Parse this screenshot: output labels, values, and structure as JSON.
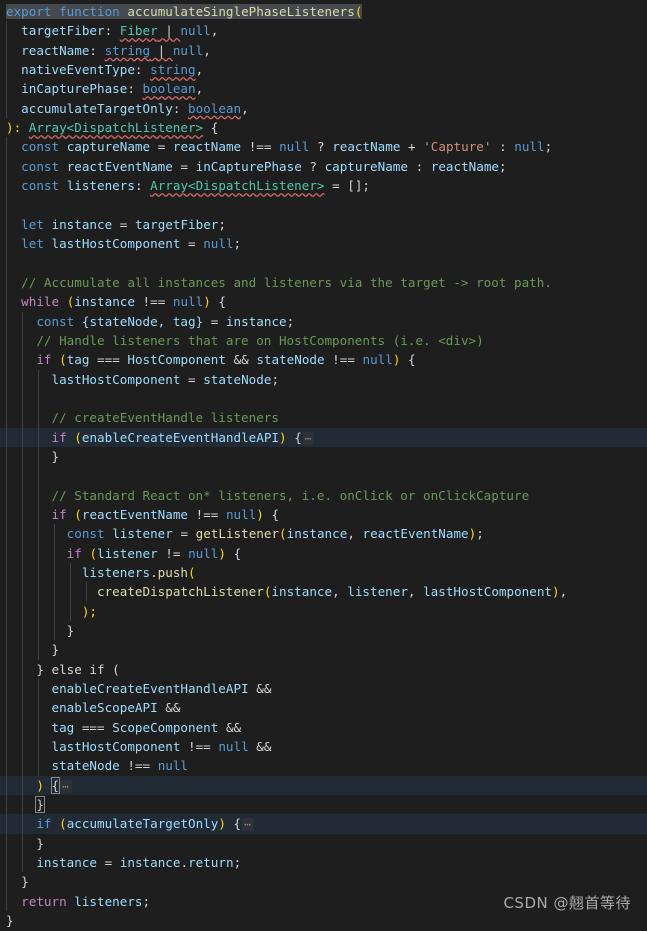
{
  "editor": {
    "language": "flow-javascript",
    "theme": "dark-plus",
    "background": "#1E1E1E",
    "foreground": "#D4D4D4",
    "selection_color": "#46494E",
    "highlight_color": "#222B35",
    "colors": {
      "keyword": "#569CD6",
      "control": "#C586C0",
      "function": "#DCDCAA",
      "identifier": "#9CDCFE",
      "type": "#4EC9B0",
      "string": "#CE9178",
      "comment": "#6A9955",
      "punctuation": "#D4D4D4",
      "error_squiggle": "#D16969",
      "fold_placeholder": "#8A8A8A"
    },
    "fold_placeholder": "⋯"
  },
  "code": {
    "l1": {
      "a": "export",
      "b": "function",
      "c": "accumulateSinglePhaseListeners",
      "d": "("
    },
    "l2": {
      "a": "targetFiber",
      "b": ": ",
      "c": "Fiber",
      "d": " | ",
      "e": "null",
      "f": ","
    },
    "l3": {
      "a": "reactName",
      "b": ": ",
      "c": "string",
      "d": " | ",
      "e": "null",
      "f": ","
    },
    "l4": {
      "a": "nativeEventType",
      "b": ": ",
      "c": "string",
      "d": ","
    },
    "l5": {
      "a": "inCapturePhase",
      "b": ": ",
      "c": "boolean",
      "d": ","
    },
    "l6": {
      "a": "accumulateTargetOnly",
      "b": ": ",
      "c": "boolean",
      "d": ","
    },
    "l7": {
      "a": "): ",
      "b": "Array<DispatchListener>",
      "c": " {"
    },
    "l8": {
      "a": "const",
      "b": "captureName",
      "c": "reactName",
      "d": "!==",
      "e": "null",
      "f": "?",
      "g": "reactName",
      "h": "+",
      "i": "'Capture'",
      "j": ":",
      "k": "null",
      "l": ";"
    },
    "l9": {
      "a": "const",
      "b": "reactEventName",
      "c": "inCapturePhase",
      "d": "?",
      "e": "captureName",
      "f": ":",
      "g": "reactName",
      "h": ";"
    },
    "l10": {
      "a": "const",
      "b": "listeners",
      "c": "Array<DispatchListener>",
      "d": " = [];"
    },
    "l11": "",
    "l12": {
      "a": "let",
      "b": "instance",
      "c": "targetFiber",
      "d": ";"
    },
    "l13": {
      "a": "let",
      "b": "lastHostComponent",
      "c": "null",
      "d": ";"
    },
    "l14": "",
    "l15": {
      "comment": "// Accumulate all instances and listeners via the target -> root path."
    },
    "l16": {
      "a": "while",
      "b": "instance",
      "c": "!==",
      "d": "null"
    },
    "l17": {
      "a": "const",
      "b": "{stateNode, tag}",
      "c": "instance"
    },
    "l18": {
      "comment": "// Handle listeners that are on HostComponents (i.e. <div>)"
    },
    "l19": {
      "a": "if",
      "b": "tag",
      "c": "===",
      "d": "HostComponent",
      "e": "&&",
      "f": "stateNode",
      "g": "!==",
      "h": "null"
    },
    "l20": {
      "a": "lastHostComponent",
      "b": "stateNode"
    },
    "l21": "",
    "l22": {
      "comment": "// createEventHandle listeners"
    },
    "l23": {
      "a": "if",
      "b": "enableCreateEventHandleAPI",
      "folded": true
    },
    "l24": {
      "a": "}"
    },
    "l25": "",
    "l26": {
      "comment": "// Standard React on* listeners, i.e. onClick or onClickCapture"
    },
    "l27": {
      "a": "if",
      "b": "reactEventName",
      "c": "!==",
      "d": "null"
    },
    "l28": {
      "a": "const",
      "b": "listener",
      "c": "getListener",
      "d": "instance",
      "e": "reactEventName"
    },
    "l29": {
      "a": "if",
      "b": "listener",
      "c": "!=",
      "d": "null"
    },
    "l30": {
      "a": "listeners",
      "b": "push"
    },
    "l31": {
      "a": "createDispatchListener",
      "b": "instance",
      "c": "listener",
      "d": "lastHostComponent"
    },
    "l32": {
      "a": ");"
    },
    "l33": {
      "a": "}"
    },
    "l34": {
      "a": "}"
    },
    "l35": {
      "a": "} else if ("
    },
    "l36": {
      "a": "enableCreateEventHandleAPI",
      "b": "&&"
    },
    "l37": {
      "a": "enableScopeAPI",
      "b": "&&"
    },
    "l38": {
      "a": "tag",
      "b": "===",
      "c": "ScopeComponent",
      "d": "&&"
    },
    "l39": {
      "a": "lastHostComponent",
      "b": "!==",
      "c": "null",
      "d": "&&"
    },
    "l40": {
      "a": "stateNode",
      "b": "!==",
      "c": "null"
    },
    "l41": {
      "a": ")",
      "b": "{",
      "folded": true
    },
    "l42": {
      "a": "}"
    },
    "l43": {
      "a": "if",
      "b": "accumulateTargetOnly",
      "folded": true
    },
    "l44": {
      "a": "}"
    },
    "l45": {
      "a": "instance",
      "b": "instance",
      "c": "return",
      "d": ";"
    },
    "l46": {
      "a": "}"
    },
    "l47": {
      "a": "return",
      "b": "listeners",
      "c": ";"
    },
    "l48": {
      "a": "}"
    }
  },
  "watermark": {
    "text": "CSDN @翹首等待"
  }
}
